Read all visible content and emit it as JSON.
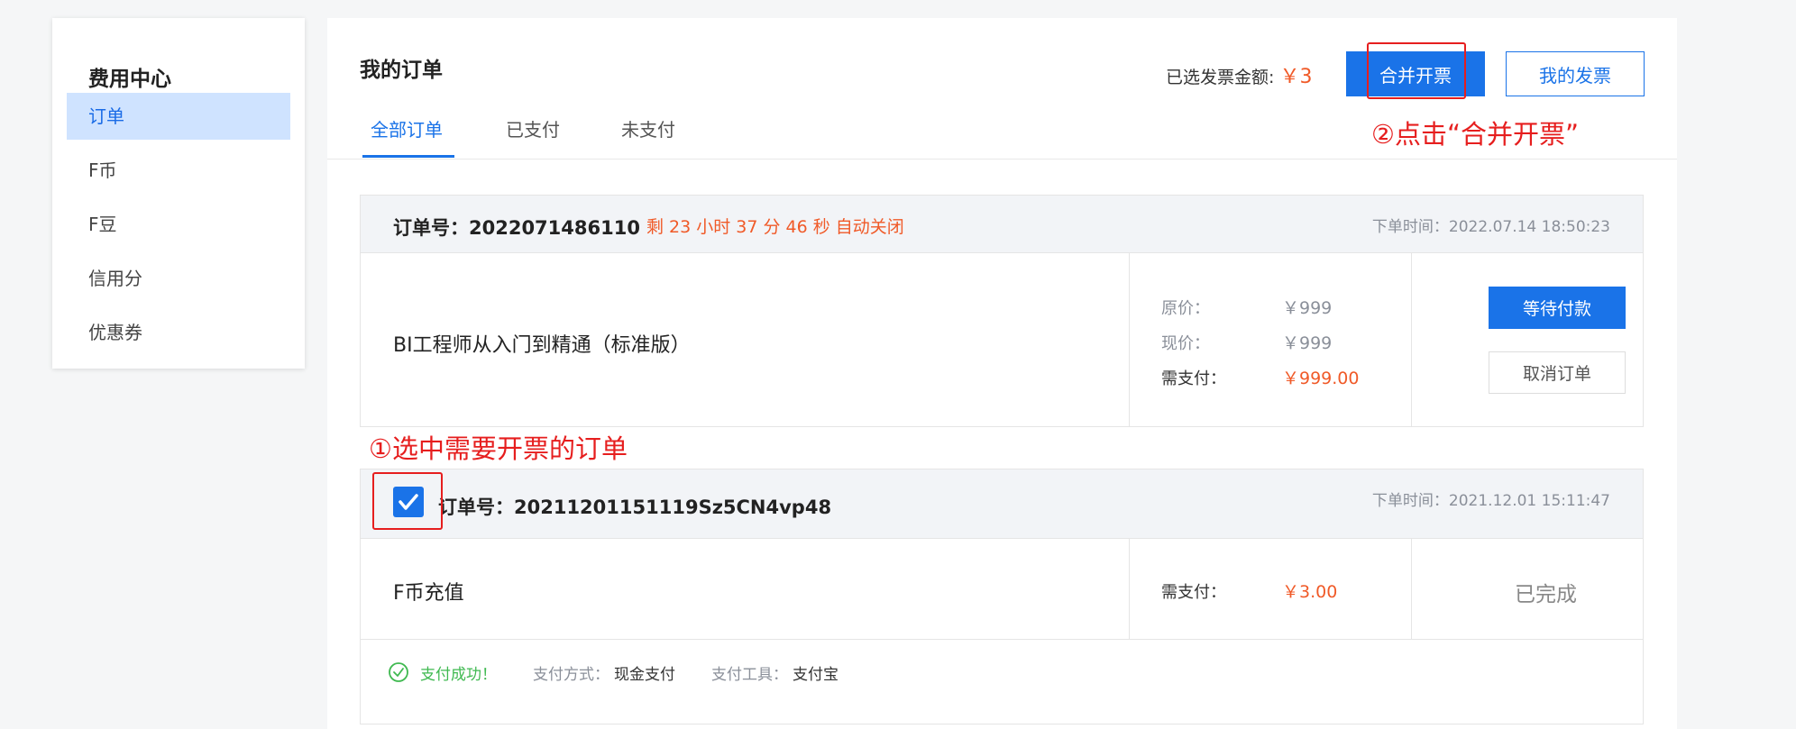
{
  "sidebar": {
    "title": "费用中心",
    "items": [
      {
        "label": "订单"
      },
      {
        "label": "F币"
      },
      {
        "label": "F豆"
      },
      {
        "label": "信用分"
      },
      {
        "label": "优惠券"
      }
    ]
  },
  "header": {
    "title": "我的订单",
    "tabs": [
      "全部订单",
      "已支付",
      "未支付"
    ],
    "selected_amount_label": "已选发票金额: ",
    "selected_amount_value": "￥3",
    "merge_button": "合并开票",
    "my_invoice_button": "我的发票"
  },
  "annotations": {
    "step1": "①选中需要开票的订单",
    "step2": "②点击“合并开票”"
  },
  "orders": [
    {
      "order_no": "订单号：2022071486110",
      "countdown": "剩 23 小时 37 分 46 秒 自动关闭",
      "time": "下单时间：2022.07.14 18:50:23",
      "product": "BI工程师从入门到精通（标准版）",
      "original_label": "原价：",
      "original_value": "￥999",
      "current_label": "现价：",
      "current_value": "￥999",
      "due_label": "需支付：",
      "due_value": "￥999.00",
      "pay_button": "等待付款",
      "cancel_button": "取消订单"
    },
    {
      "order_no": "订单号：20211201151119Sz5CN4vp48",
      "checked": true,
      "time": "下单时间：2021.12.01 15:11:47",
      "product": "F币充值",
      "due_label": "需支付：",
      "due_value": "￥3.00",
      "status": "已完成",
      "pay_success": "支付成功！",
      "pay_method_label": "支付方式：",
      "pay_method_value": "现金支付",
      "pay_tool_label": "支付工具：",
      "pay_tool_value": "支付宝"
    }
  ],
  "colors": {
    "primary": "#1a73e8",
    "price_orange": "#f05a28",
    "annotation_red": "#e61e1e",
    "success_green": "#3fb950"
  }
}
